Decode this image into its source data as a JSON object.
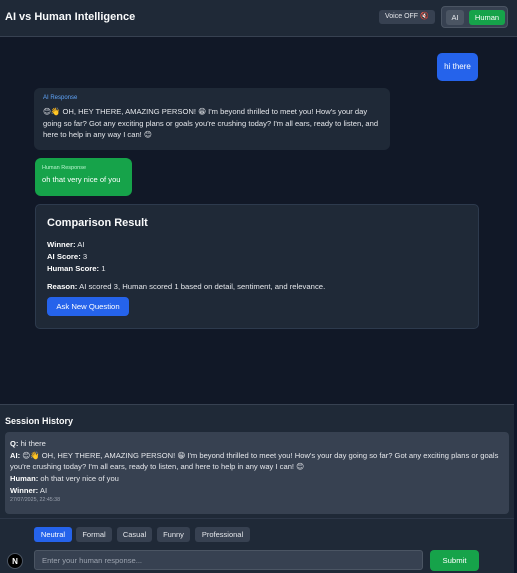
{
  "header": {
    "title": "AI vs Human Intelligence",
    "voice_label": "Voice OFF 🔇",
    "mode_ai": "AI",
    "mode_human": "Human"
  },
  "chat": {
    "user_message": "hi there",
    "ai_label": "AI Response",
    "ai_message": "😊👋 OH, HEY THERE, AMAZING PERSON! 😁 I'm beyond thrilled to meet you! How's your day going so far? Got any exciting plans or goals you're crushing today? I'm all ears, ready to listen, and here to help in any way I can! 😊",
    "human_label": "Human Response",
    "human_message": "oh that very nice of you"
  },
  "result": {
    "title": "Comparison Result",
    "winner_label": "Winner:",
    "winner_value": "AI",
    "ai_score_label": "AI Score:",
    "ai_score_value": "3",
    "human_score_label": "Human Score:",
    "human_score_value": "1",
    "reason_label": "Reason:",
    "reason_value": "AI scored 3, Human scored 1 based on detail, sentiment, and relevance.",
    "ask_button": "Ask New Question"
  },
  "history": {
    "title": "Session History",
    "q_label": "Q:",
    "q_value": "hi there",
    "ai_label": "AI:",
    "ai_value": "😊👋 OH, HEY THERE, AMAZING PERSON! 😁 I'm beyond thrilled to meet you! How's your day going so far? Got any exciting plans or goals you're crushing today? I'm all ears, ready to listen, and here to help in any way I can! 😊",
    "human_label": "Human:",
    "human_value": "oh that very nice of you",
    "winner_label": "Winner:",
    "winner_value": "AI",
    "timestamp": "27/07/2025, 22:45:38"
  },
  "footer": {
    "tones": [
      "Neutral",
      "Formal",
      "Casual",
      "Funny",
      "Professional"
    ],
    "active_tone": "Neutral",
    "input_placeholder": "Enter your human response...",
    "input_value": "",
    "submit_label": "Submit",
    "logo_letter": "N"
  },
  "colors": {
    "background": "#111827",
    "panel": "#1f2937",
    "accent_blue": "#2563eb",
    "accent_green": "#16a34a"
  }
}
